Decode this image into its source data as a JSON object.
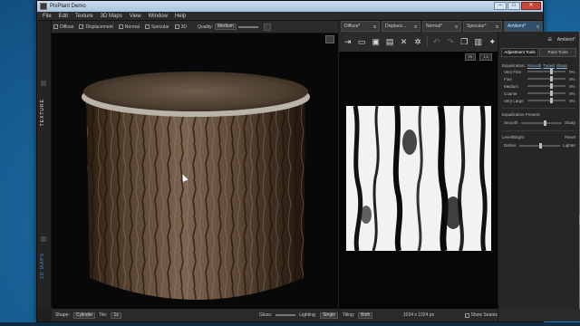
{
  "window": {
    "title": "PixPlant Demo",
    "controls": {
      "minimize": "–",
      "maximize": "□",
      "close": "✕"
    }
  },
  "menu": [
    "File",
    "Edit",
    "Texture",
    "3D Maps",
    "View",
    "Window",
    "Help"
  ],
  "viewport": {
    "toggles": [
      {
        "label": "Diffuse",
        "checked": true
      },
      {
        "label": "Displacement",
        "checked": true
      },
      {
        "label": "Normal",
        "checked": true
      },
      {
        "label": "Specular",
        "checked": true
      },
      {
        "label": "3D",
        "checked": true
      }
    ],
    "quality_label": "Quality:",
    "quality_value": "Medium",
    "side_tabs": {
      "texture": "TEXTURE",
      "maps3d": "3D MAPS"
    },
    "bottom": {
      "shape_label": "Shape:",
      "shape_value": "Cylinder",
      "tile_label": "Tile:",
      "tile_value": "1x",
      "gloss_label": "Gloss:",
      "lighting_label": "Lighting:",
      "lighting_value": "Single"
    }
  },
  "map_tabs": [
    {
      "label": "Diffuse*",
      "active": false
    },
    {
      "label": "Displace...",
      "active": false
    },
    {
      "label": "Normal*",
      "active": false
    },
    {
      "label": "Specular*",
      "active": false
    },
    {
      "label": "Ambient*",
      "active": true
    }
  ],
  "map_toolbar": {
    "icons": [
      "import-icon",
      "open-icon",
      "save-icon",
      "save-all-icon",
      "close-icon",
      "settings-icon",
      "undo-icon",
      "redo-icon",
      "copy-icon",
      "paste-icon",
      "generate-icon"
    ],
    "fit_label": "Fit",
    "one_to_one_label": "1:1"
  },
  "map_bottom": {
    "tiling_label": "Tiling:",
    "tiling_value": "Both",
    "resolution": "1024 x 1024 px",
    "show_seams_label": "Show Seams",
    "show_seams_checked": true
  },
  "panel": {
    "title": "Ambient*",
    "tabs": [
      "Adjustment Tools",
      "Paint Tools"
    ],
    "eq_label": "Equalization:",
    "eq_modes": [
      "Smooth",
      "Tuned",
      "Sharp"
    ],
    "eq_rows": [
      {
        "label": "Very Fine",
        "value": "0%",
        "pos": 0.6
      },
      {
        "label": "Fine",
        "value": "0%",
        "pos": 0.6
      },
      {
        "label": "Medium",
        "value": "0%",
        "pos": 0.6
      },
      {
        "label": "Coarse",
        "value": "0%",
        "pos": 0.6
      },
      {
        "label": "Very Large",
        "value": "0%",
        "pos": 0.6
      }
    ],
    "presets_label": "Equalization Presets:",
    "preset_left": "Smooth",
    "preset_right": "Sharp",
    "preset_pos": 0.55,
    "levels_label": "Level/Bright:",
    "levels_reset": "Reset",
    "darker_label": "Darker",
    "lighter_label": "Lighter",
    "darker_pos": 0.5
  }
}
